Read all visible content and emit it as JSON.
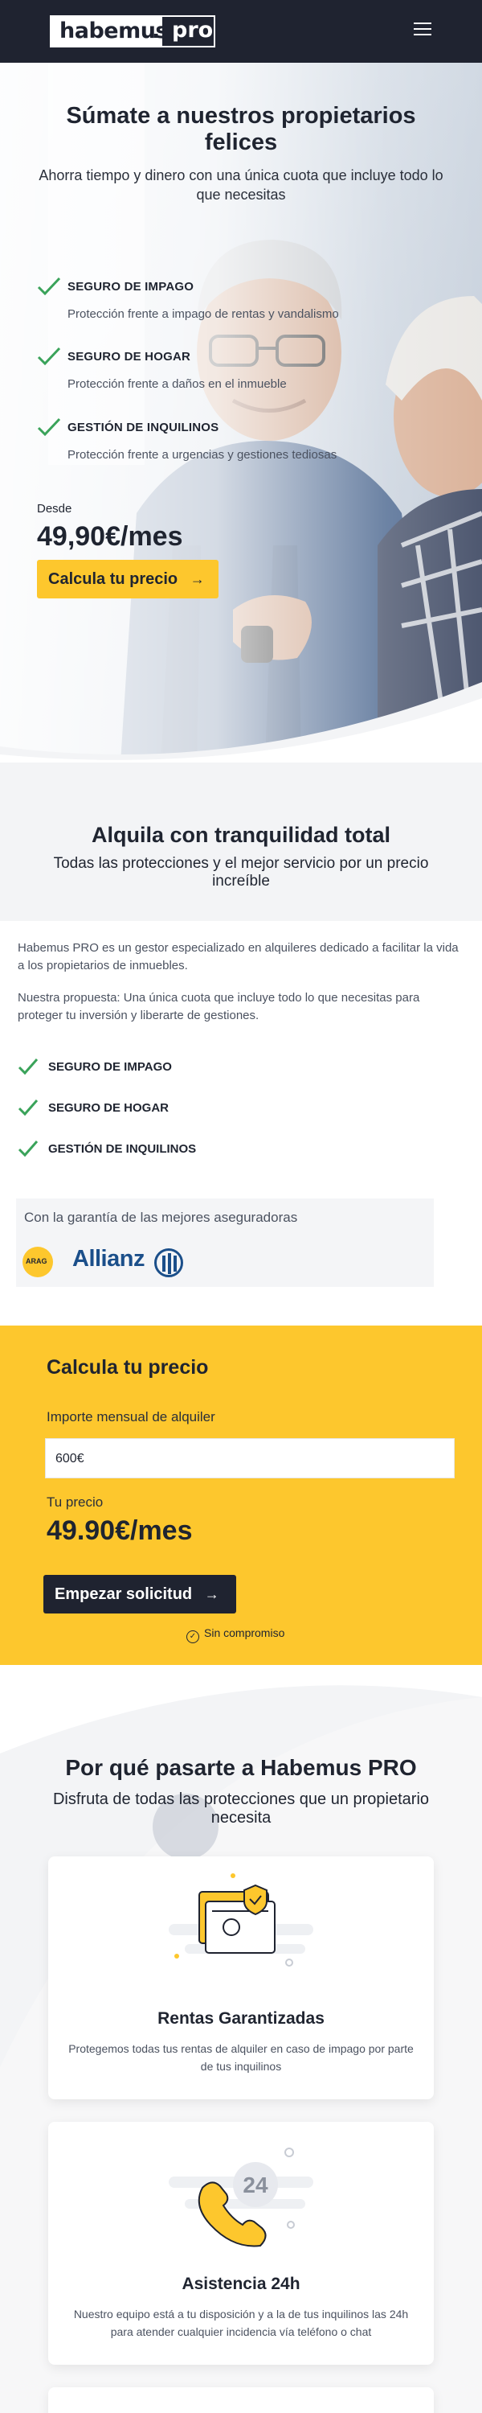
{
  "header": {
    "logo_word": "habemus",
    "logo_dot": ".",
    "logo_pro": "pro"
  },
  "hero": {
    "title_line1": "Súmate a nuestros propietarios",
    "title_line2": "felices",
    "subtitle": "Ahorra tiempo y dinero con una única cuota que incluye todo lo que necesitas",
    "features": [
      {
        "title": "SEGURO DE IMPAGO",
        "desc": "Protección frente a impago de rentas y vandalismo"
      },
      {
        "title": "SEGURO DE HOGAR",
        "desc": "Protección frente a daños en el inmueble"
      },
      {
        "title": "GESTIÓN DE INQUILINOS",
        "desc": "Protección frente a urgencias y gestiones tediosas"
      }
    ],
    "from_label": "Desde",
    "price": "49,90€/mes",
    "cta_label": "Calcula tu precio",
    "cta_arrow": "→"
  },
  "about": {
    "title": "Alquila con tranquilidad total",
    "subtitle": "Todas las protecciones y el mejor servicio por un precio increíble",
    "paragraph1": "Habemus PRO es un gestor especializado en alquileres dedicado a facilitar la vida a los propietarios de inmuebles.",
    "paragraph2": "Nuestra propuesta: Una única cuota que incluye todo lo que necesitas para proteger tu inversión y liberarte de gestiones.",
    "items": [
      "SEGURO DE IMPAGO",
      "SEGURO DE HOGAR",
      "GESTIÓN DE INQUILINOS"
    ],
    "guarantee_text": "Con la garantía de las mejores aseguradoras",
    "insurer1": "ARAG",
    "insurer2": "Allianz"
  },
  "calculator": {
    "title": "Calcula tu precio",
    "rent_label": "Importe mensual de alquiler",
    "rent_value": "600€",
    "price_label": "Tu precio",
    "price_value": "49.90€/mes",
    "button_label": "Empezar solicitud",
    "button_arrow": "→",
    "note": "Sin compromiso"
  },
  "why": {
    "title": "Por qué pasarte a Habemus PRO",
    "subtitle": "Disfruta de todas las protecciones que un propietario necesita",
    "cards": [
      {
        "title": "Rentas Garantizadas",
        "desc": "Protegemos todas tus rentas de alquiler en caso de impago por parte de tus inquilinos",
        "icon": "money-shield-icon"
      },
      {
        "title": "Asistencia 24h",
        "desc": "Nuestro equipo está a tu disposición y a la de tus inquilinos las 24h para atender cualquier incidencia vía teléfono o chat",
        "icon": "phone-24h-icon",
        "badge": "24"
      }
    ]
  },
  "colors": {
    "navy": "#1f2330",
    "yellow": "#fdc72d",
    "green_check": "#3aa35a",
    "allianz_blue": "#1b4f8a"
  }
}
